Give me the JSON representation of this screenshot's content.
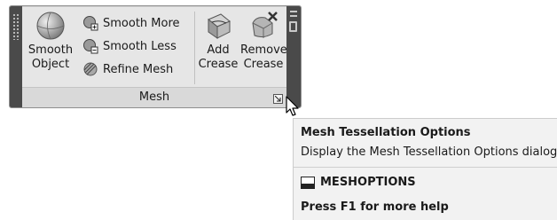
{
  "panel": {
    "title": "Mesh",
    "buttons": {
      "smooth_object": {
        "line1": "Smooth",
        "line2": "Object",
        "icon": "smooth-sphere-icon"
      },
      "smooth_more": {
        "label": "Smooth More",
        "icon": "smooth-more-icon"
      },
      "smooth_less": {
        "label": "Smooth Less",
        "icon": "smooth-less-icon"
      },
      "refine_mesh": {
        "label": "Refine Mesh",
        "icon": "refine-mesh-icon"
      },
      "add_crease": {
        "line1": "Add",
        "line2": "Crease",
        "icon": "add-crease-icon"
      },
      "remove_crease": {
        "line1": "Remove",
        "line2": "Crease",
        "icon": "remove-crease-icon"
      }
    }
  },
  "tooltip": {
    "title": "Mesh Tessellation Options",
    "description": "Display the Mesh Tessellation Options dialog box",
    "command": "MESHOPTIONS",
    "help": "Press F1 for more help"
  },
  "colors": {
    "panel_bg": "#e6e6e6",
    "frame_dark": "#4a4a4a",
    "tooltip_bg": "#f2f2f2"
  }
}
